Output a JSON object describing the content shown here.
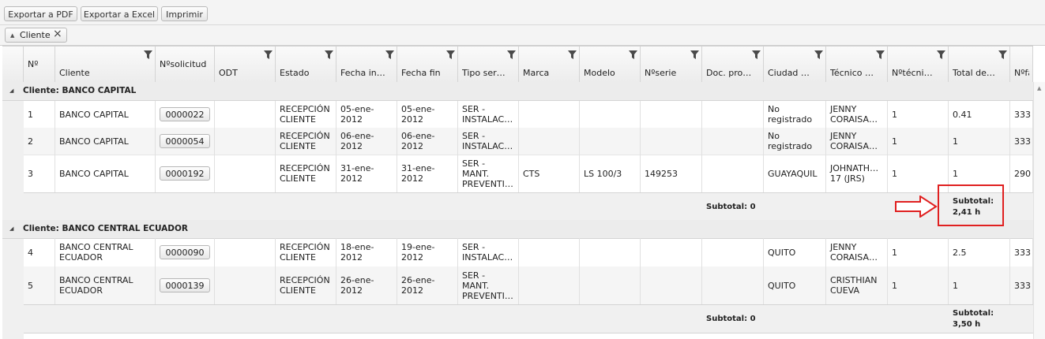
{
  "toolbar": {
    "export_pdf": "Exportar a PDF",
    "export_excel": "Exportar a Excel",
    "print": "Imprimir"
  },
  "grouping": {
    "chip_label": "Cliente"
  },
  "columns": [
    {
      "label": "Nº",
      "filter": false
    },
    {
      "label": "Cliente",
      "filter": true
    },
    {
      "label": "Nºsolicitud",
      "filter": false
    },
    {
      "label": "ODT",
      "filter": true
    },
    {
      "label": "Estado",
      "filter": true
    },
    {
      "label": "Fecha in…",
      "filter": true
    },
    {
      "label": "Fecha fin",
      "filter": true
    },
    {
      "label": "Tipo ser…",
      "filter": true
    },
    {
      "label": "Marca",
      "filter": true
    },
    {
      "label": "Modelo",
      "filter": true
    },
    {
      "label": "Nºserie",
      "filter": true
    },
    {
      "label": "Doc. pro…",
      "filter": true
    },
    {
      "label": "Ciudad …",
      "filter": true
    },
    {
      "label": "Técnico …",
      "filter": true
    },
    {
      "label": "Nºtécni…",
      "filter": true
    },
    {
      "label": "Total de…",
      "filter": true
    },
    {
      "label": "Nºfa",
      "filter": false
    }
  ],
  "groups": [
    {
      "title": "Cliente: BANCO CAPITAL",
      "rows": [
        [
          "1",
          "BANCO CAPITAL",
          "0000022",
          "",
          "RECEPCIÓN\nCLIENTE",
          "05-ene-\n2012",
          "05-ene-\n2012",
          "SER -\nINSTALAC…",
          "",
          "",
          "",
          "",
          "No\nregistrado",
          "JENNY\nCORAISA…",
          "1",
          "0.41",
          "333"
        ],
        [
          "2",
          "BANCO CAPITAL",
          "0000054",
          "",
          "RECEPCIÓN\nCLIENTE",
          "06-ene-\n2012",
          "06-ene-\n2012",
          "SER -\nINSTALAC…",
          "",
          "",
          "",
          "",
          "No\nregistrado",
          "JENNY\nCORAISA…",
          "1",
          "1",
          "333"
        ],
        [
          "3",
          "BANCO CAPITAL",
          "0000192",
          "",
          "RECEPCIÓN\nCLIENTE",
          "31-ene-\n2012",
          "31-ene-\n2012",
          "SER -\nMANT.\nPREVENTI…",
          "CTS",
          "LS 100/3",
          "149253",
          "",
          "GUAYAQUIL",
          "JOHNATH…\n17 (JRS)",
          "1",
          "1",
          "290"
        ]
      ],
      "subtotal_left": "Subtotal: 0",
      "subtotal_right": "Subtotal:\n2,41 h"
    },
    {
      "title": "Cliente: BANCO CENTRAL ECUADOR",
      "rows": [
        [
          "4",
          "BANCO CENTRAL\nECUADOR",
          "0000090",
          "",
          "RECEPCIÓN\nCLIENTE",
          "18-ene-\n2012",
          "19-ene-\n2012",
          "SER -\nINSTALAC…",
          "",
          "",
          "",
          "",
          "QUITO",
          "JENNY\nCORAISA…",
          "1",
          "2.5",
          "333"
        ],
        [
          "5",
          "BANCO CENTRAL\nECUADOR",
          "0000139",
          "",
          "RECEPCIÓN\nCLIENTE",
          "26-ene-\n2012",
          "26-ene-\n2012",
          "SER -\nMANT.\nPREVENTI…",
          "",
          "",
          "",
          "",
          "QUITO",
          "CRISTHIAN\nCUEVA",
          "1",
          "1",
          "333"
        ]
      ],
      "subtotal_left": "Subtotal: 0",
      "subtotal_right": "Subtotal:\n3,50 h"
    }
  ],
  "colors": {
    "annotation": "#e02020"
  },
  "icons": [
    "filter-icon",
    "collapse-icon",
    "close-icon",
    "arrow-annotation",
    "scroll-up-icon"
  ]
}
